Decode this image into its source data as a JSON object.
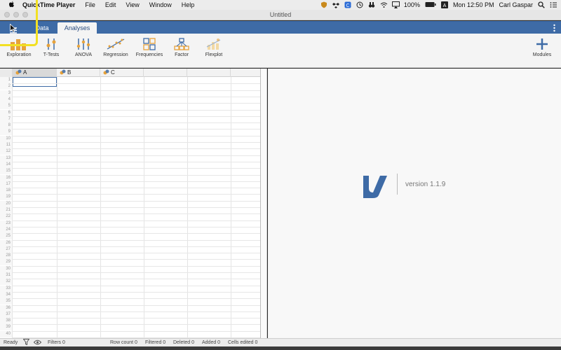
{
  "menubar": {
    "apple_icon": "apple-icon",
    "app_name": "QuickTime Player",
    "items": [
      "File",
      "Edit",
      "View",
      "Window",
      "Help"
    ],
    "battery": "100%",
    "clock": "Mon 12:50 PM",
    "user": "Carl Gaspar"
  },
  "window": {
    "title": "Untitled"
  },
  "tabs": {
    "data": "Data",
    "analyses": "Analyses"
  },
  "ribbon": {
    "exploration": "Exploration",
    "ttests": "T-Tests",
    "anova": "ANOVA",
    "regression": "Regression",
    "frequencies": "Frequencies",
    "factor": "Factor",
    "flexplot": "Flexplot",
    "modules": "Modules"
  },
  "sheet": {
    "columns": [
      "A",
      "B",
      "C"
    ],
    "rows": [
      "1",
      "2",
      "3",
      "4",
      "5",
      "6",
      "7",
      "8",
      "9",
      "10",
      "11",
      "12",
      "13",
      "14",
      "15",
      "16",
      "17",
      "18",
      "19",
      "20",
      "21",
      "22",
      "23",
      "24",
      "25",
      "26",
      "27",
      "28",
      "29",
      "30",
      "31",
      "32",
      "33",
      "34",
      "35",
      "36",
      "37",
      "38",
      "39",
      "40"
    ]
  },
  "results": {
    "version": "version 1.1.9"
  },
  "status": {
    "ready": "Ready",
    "filters": "Filters 0",
    "row_count": "Row count 0",
    "filtered": "Filtered 0",
    "deleted": "Deleted 0",
    "added": "Added 0",
    "cells_edited": "Cells edited 0"
  },
  "colors": {
    "accent": "#3e6ba6",
    "highlight": "#f2e023"
  }
}
